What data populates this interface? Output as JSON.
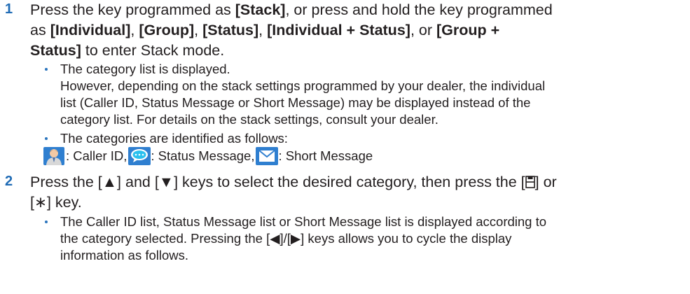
{
  "step1": {
    "number": "1",
    "line1_a": "Press the key programmed as ",
    "line1_key": "[Stack]",
    "line1_b": ", or press and hold the key programmed",
    "line2_a": "as ",
    "line2_k1": "[Individual]",
    "comma1": ", ",
    "line2_k2": "[Group]",
    "comma2": ", ",
    "line2_k3": "[Status]",
    "comma3": ", ",
    "line2_k4": "[Individual + Status]",
    "line2_or": ", or ",
    "line2_k5": "[Group +",
    "line3_k5": "Status]",
    "line3_b": " to enter Stack mode.",
    "bullet1_l1": "The category list is displayed.",
    "bullet1_l2": "However, depending on the stack settings programmed by your dealer, the individual",
    "bullet1_l3": "list (Caller ID, Status Message or Short Message) may be displayed instead of the",
    "bullet1_l4": "category list. For details on the stack settings, consult your dealer.",
    "bullet2_l1": "The categories are identified as follows:",
    "cat1": ": Caller ID, ",
    "cat2": ": Status Message, ",
    "cat3": ": Short Message"
  },
  "step2": {
    "number": "2",
    "line1": "Press the [▲] and [▼] keys to select the desired category, then press the [",
    "line1_end": "] or",
    "line2": "[∗] key.",
    "bullet1_l1": "The Caller ID list, Status Message list or Short Message list is displayed according to",
    "bullet1_l2": "the category selected. Pressing the [◀]/[▶] keys allows you to cycle the display",
    "bullet1_l3": "information as follows."
  },
  "icons": [
    "caller-id-icon",
    "status-message-icon",
    "short-message-icon",
    "menu-key-icon"
  ],
  "colors": {
    "step_number": "#1f6bb5",
    "bullet": "#2a74bd",
    "icon_bg": "#2f7fd0"
  }
}
